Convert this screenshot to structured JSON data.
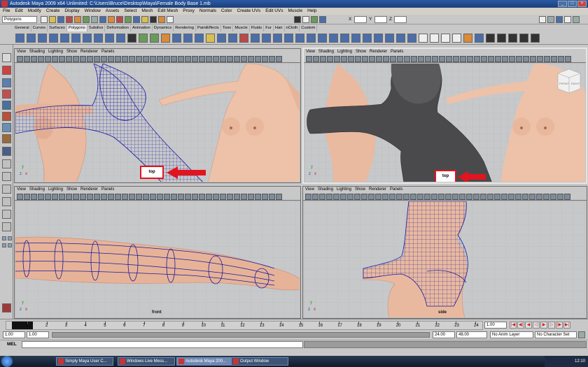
{
  "window": {
    "title": "Autodesk Maya 2009 x64 Unlimited: C:\\Users\\Bruce\\Desktop\\Maya\\Female Body Base 1.mb"
  },
  "menu": [
    "File",
    "Edit",
    "Modify",
    "Create",
    "Display",
    "Window",
    "Assets",
    "Select",
    "Mesh",
    "Edit Mesh",
    "Proxy",
    "Normals",
    "Color",
    "Create UVs",
    "Edit UVs",
    "Muscle",
    "Help"
  ],
  "status_line": {
    "mode": "Polygons",
    "x_label": "X",
    "y_label": "Y",
    "z_label": "Z"
  },
  "shelf_tabs": [
    "General",
    "Curves",
    "Surfaces",
    "Polygons",
    "Subdivs",
    "Deformation",
    "Animation",
    "Dynamics",
    "Rendering",
    "PaintEffects",
    "Toon",
    "Muscle",
    "Fluids",
    "Fur",
    "Hair",
    "nCloth",
    "Custom"
  ],
  "shelf_active_tab": "Polygons",
  "panel_menu": [
    "View",
    "Shading",
    "Lighting",
    "Show",
    "Renderer",
    "Panels"
  ],
  "panels": [
    {
      "id": "top-left",
      "camera": "top"
    },
    {
      "id": "top-right",
      "camera": "top",
      "viewcube": {
        "front": "FRONT",
        "right": "RIGHT"
      }
    },
    {
      "id": "bottom-left",
      "camera": "front"
    },
    {
      "id": "bottom-right",
      "camera": "side"
    }
  ],
  "axes": {
    "y": "y",
    "z": "z",
    "x": "x"
  },
  "annotations": {
    "color": "#e2141e"
  },
  "timeline": {
    "ticks": [
      1,
      2,
      3,
      4,
      5,
      6,
      7,
      8,
      9,
      10,
      11,
      12,
      13,
      14,
      15,
      16,
      17,
      18,
      19,
      20,
      21,
      22,
      23,
      24
    ],
    "current_time": "1.00"
  },
  "range": {
    "start_time": "1.00",
    "start_range": "1.00",
    "end_range": "24.00",
    "end_time": "48.00",
    "anim_layer": "No Anim Layer",
    "character_set": "No Character Set"
  },
  "command_line": {
    "label": "MEL"
  },
  "taskbar": {
    "items": [
      {
        "label": "Simply Maya User C...",
        "active": false
      },
      {
        "label": "Windows Live Mess...",
        "active": false
      },
      {
        "label": "Autodesk Maya 200...",
        "active": true
      },
      {
        "label": "Output Window",
        "active": false
      }
    ],
    "clock": "12:10"
  }
}
